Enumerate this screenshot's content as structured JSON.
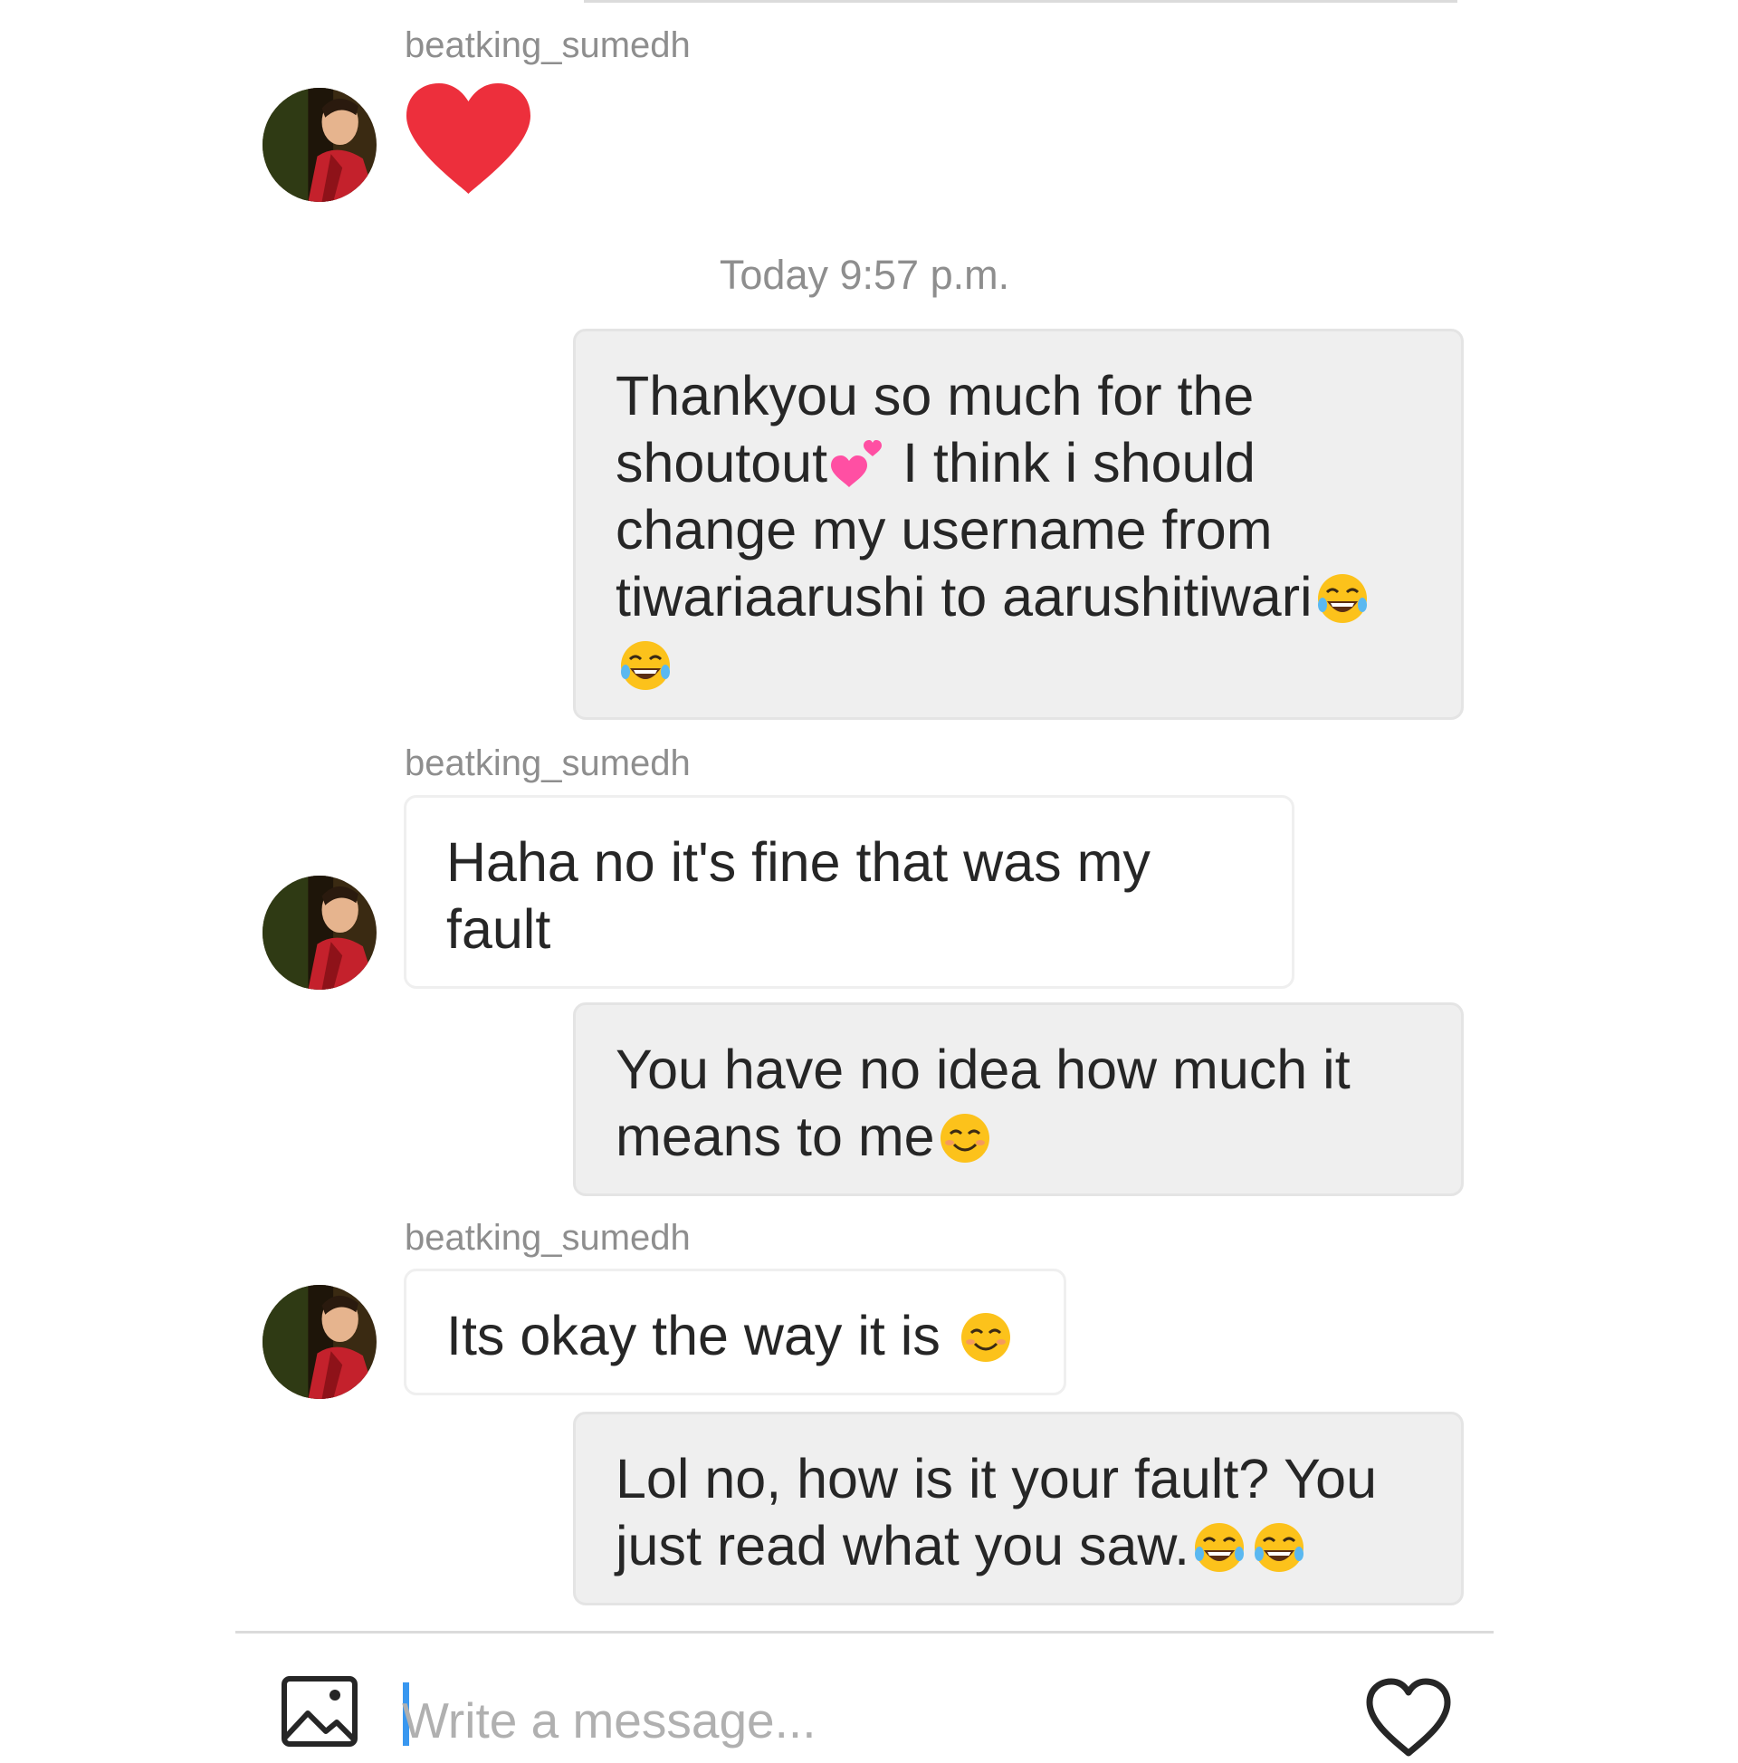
{
  "conversation": {
    "other_user": "beatking_sumedh",
    "timestamp_divider": "Today 9:57 p.m.",
    "messages": [
      {
        "sender": "beatking_sumedh",
        "type": "like",
        "icon": "red-heart"
      },
      {
        "sender": "me",
        "text": "Thankyou so much for the shoutout💕 I think i should change my username from tiwariaarushi to aarushitiwari😂😂"
      },
      {
        "sender": "beatking_sumedh",
        "text": "Haha no it's fine that was my fault"
      },
      {
        "sender": "me",
        "text": "You have no idea how much it means to me😊"
      },
      {
        "sender": "beatking_sumedh",
        "text": "Its okay the way it is 😊"
      },
      {
        "sender": "me",
        "text": "Lol no, how is it your fault? You just read what you saw.😂😂"
      }
    ]
  },
  "bubbles": {
    "m2": {
      "l1": "Thankyou so much for the",
      "l2a": "shoutout",
      "l2b": " I think i should",
      "l3": "change my username from",
      "l4": "tiwariaarushi to aarushitiwari"
    },
    "m3": {
      "l1": "Haha no it's fine that was my",
      "l2": "fault"
    },
    "m4": {
      "l1": "You have no idea how much it",
      "l2": "means to me"
    },
    "m5": {
      "l1": "Its okay the way it is "
    },
    "m6": {
      "l1": "Lol no, how is it your fault? You",
      "l2": "just read what you saw."
    }
  },
  "composer": {
    "placeholder": "Write a message...",
    "gallery_icon": "image-gallery-icon",
    "like_icon": "heart-outline-icon"
  },
  "colors": {
    "sent_bubble": "#efefef",
    "received_bubble_border": "#efefef",
    "meta_text": "#8e8e8e",
    "heart_red": "#ed2f3c",
    "caret_blue": "#3897f0"
  }
}
